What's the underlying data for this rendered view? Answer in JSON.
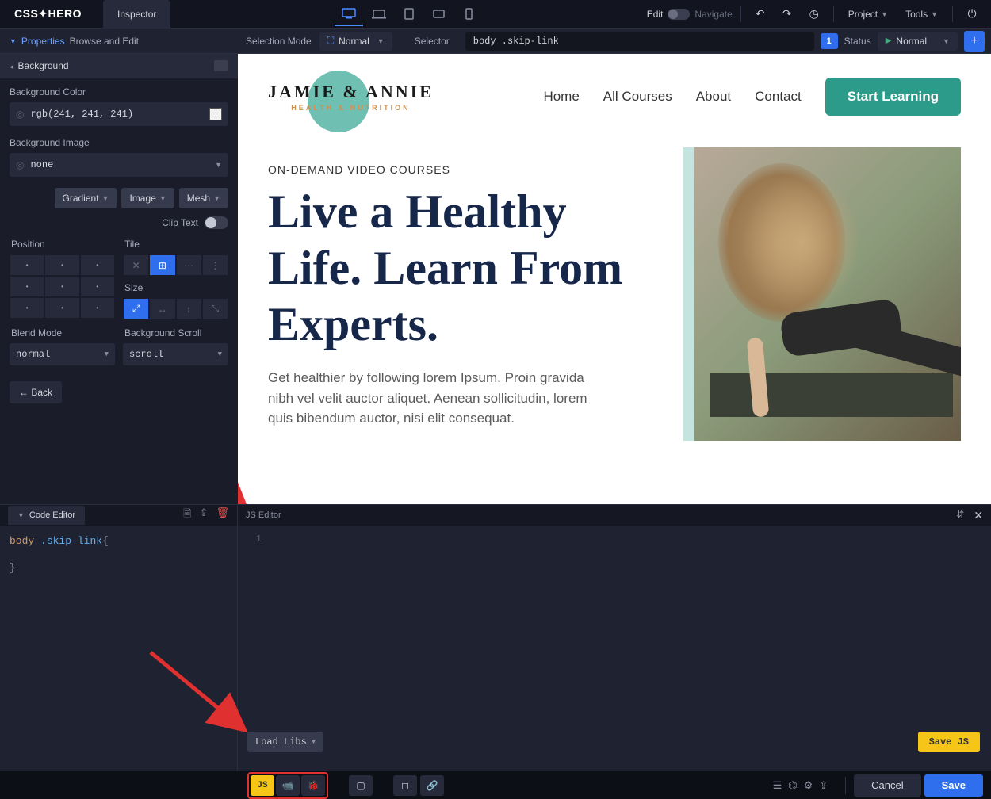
{
  "app": {
    "logo": "CSS",
    "logo2": "HERO",
    "tab": "Inspector"
  },
  "topbar": {
    "edit": "Edit",
    "navigate": "Navigate",
    "project": "Project",
    "tools": "Tools"
  },
  "secondbar": {
    "properties": "Properties",
    "browse_edit": "Browse and Edit",
    "selection_mode_label": "Selection Mode",
    "selection_mode_value": "Normal",
    "selector_label": "Selector",
    "selector_value": "body .skip-link",
    "count": "1",
    "status_label": "Status",
    "status_value": "Normal"
  },
  "sidebar": {
    "section": "Background",
    "bg_color_label": "Background Color",
    "bg_color_value": "rgb(241, 241, 241)",
    "bg_image_label": "Background Image",
    "bg_image_value": "none",
    "gradient": "Gradient",
    "image": "Image",
    "mesh": "Mesh",
    "clip_text": "Clip Text",
    "position_label": "Position",
    "tile_label": "Tile",
    "size_label": "Size",
    "blend_mode_label": "Blend Mode",
    "blend_mode_value": "normal",
    "bg_scroll_label": "Background Scroll",
    "bg_scroll_value": "scroll",
    "back": "← Back"
  },
  "site": {
    "logo_text": "JAMIE & ANNIE",
    "logo_sub": "HEALTH & NUTRITION",
    "nav": {
      "home": "Home",
      "courses": "All Courses",
      "about": "About",
      "contact": "Contact"
    },
    "cta": "Start Learning",
    "eyebrow": "ON-DEMAND VIDEO COURSES",
    "hero_title": "Live a Healthy Life. Learn From Experts.",
    "hero_desc": "Get healthier by following lorem Ipsum. Proin gravida nibh vel velit auctor aliquet. Aenean sollicitudin, lorem quis bibendum auctor, nisi elit consequat."
  },
  "bottom": {
    "code_tab": "Code Editor",
    "js_tab": "JS Editor",
    "css_line1_a": "body",
    "css_line1_b": ".skip-link",
    "css_line1_c": "{",
    "css_line2": "}",
    "line_no": "1",
    "load_libs": "Load Libs",
    "save_js": "Save JS",
    "js_badge": "JS",
    "cancel": "Cancel",
    "save": "Save"
  }
}
